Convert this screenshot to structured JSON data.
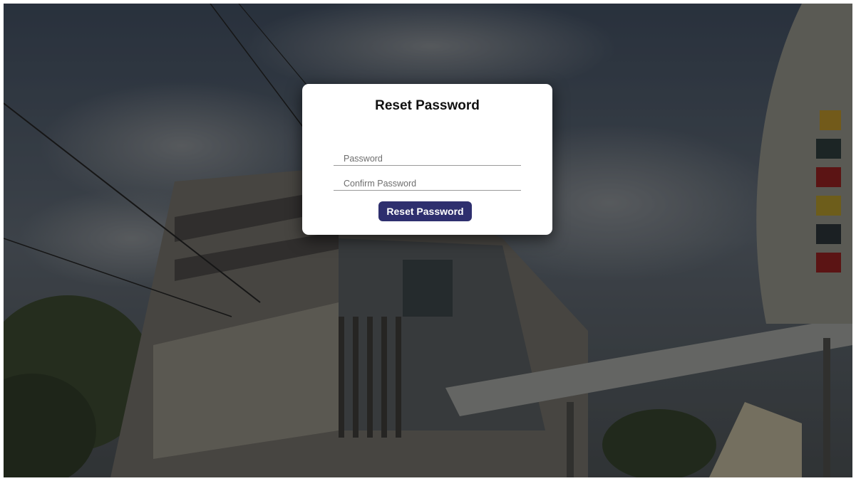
{
  "form": {
    "title": "Reset Password",
    "password_placeholder": "Password",
    "password_value": "",
    "confirm_placeholder": "Confirm Password",
    "confirm_value": "",
    "submit_label": "Reset Password"
  },
  "colors": {
    "button_bg": "#2e2f6e",
    "card_bg": "#ffffff",
    "overlay": "rgba(0,0,0,0.35)"
  }
}
